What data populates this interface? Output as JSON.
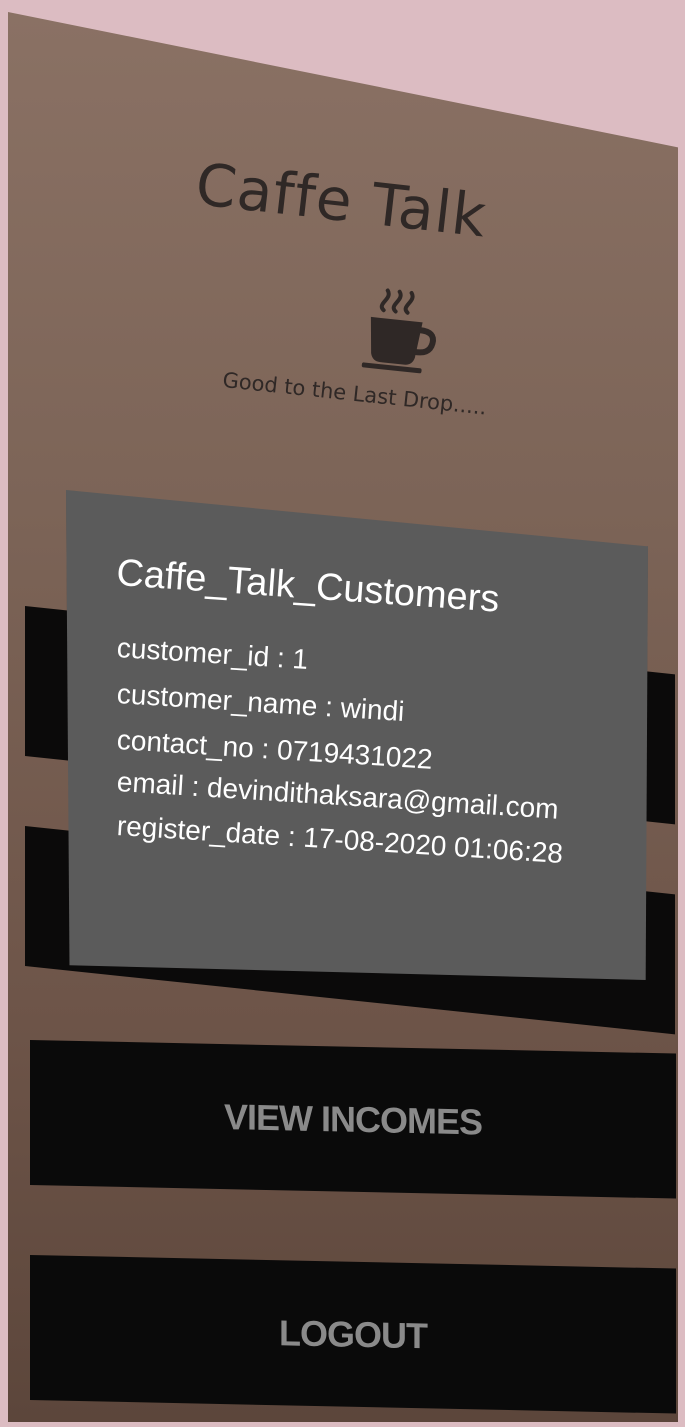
{
  "app": {
    "title": "Caffe Talk",
    "tagline": "Good to the Last Drop....."
  },
  "logo": {
    "icon": "coffee-cup-icon"
  },
  "dialog": {
    "title": "Caffe_Talk_Customers",
    "fields": [
      {
        "label": "customer_id",
        "value": "1",
        "text": "customer_id : 1"
      },
      {
        "label": "customer_name",
        "value": "windi",
        "text": "customer_name : windi"
      },
      {
        "label": "contact_no",
        "value": "0719431022",
        "text": "contact_no : 0719431022"
      },
      {
        "label": "email",
        "value": "devindithaksara@gmail.com",
        "text": "email : devindithaksara@gmail.com"
      },
      {
        "label": "register_date",
        "value": "17-08-2020 01:06:28",
        "text": "register_date : 17-08-2020 01:06:28"
      }
    ]
  },
  "buttons": {
    "view_incomes": "VIEW INCOMES",
    "logout": "LOGOUT"
  },
  "colors": {
    "background": "#dcbcc2",
    "panel_brown": "#7c6457",
    "dialog_gray": "#5b5b5b",
    "button_black": "#0a0a0a",
    "button_text": "#8a8a8a"
  }
}
